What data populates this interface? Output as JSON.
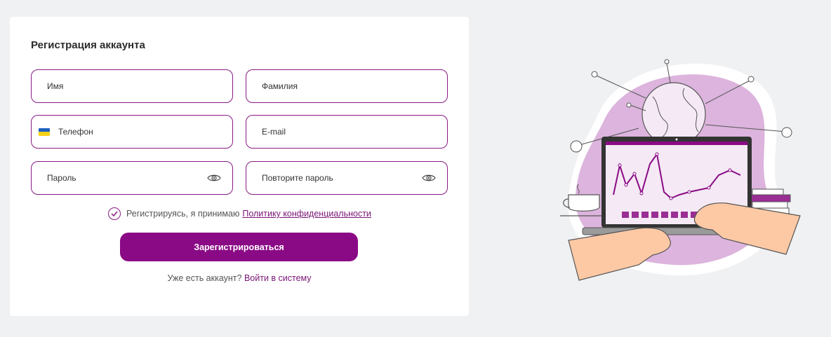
{
  "form": {
    "title": "Регистрация аккаунта",
    "fields": {
      "first_name": "Имя",
      "last_name": "Фамилия",
      "phone": "Телефон",
      "email": "E-mail",
      "password": "Пароль",
      "confirm_password": "Повторите пароль"
    },
    "consent": {
      "text": "Регистрируясь, я принимаю",
      "link": "Политику конфиденциальности",
      "checked": true
    },
    "submit_label": "Зарегистрироваться",
    "login_prompt": {
      "text": "Уже есть аккаунт?",
      "link": "Войти в систему"
    }
  },
  "icons": {
    "phone_flag": "ukraine-flag-icon",
    "password_toggle": "eye-icon",
    "consent_check": "checkmark-icon"
  },
  "colors": {
    "accent": "#8a0a85",
    "field_border": "#8a1a85",
    "background": "#f0f1f3",
    "card": "#ffffff",
    "illustration_blob": "#dcb4dd"
  }
}
